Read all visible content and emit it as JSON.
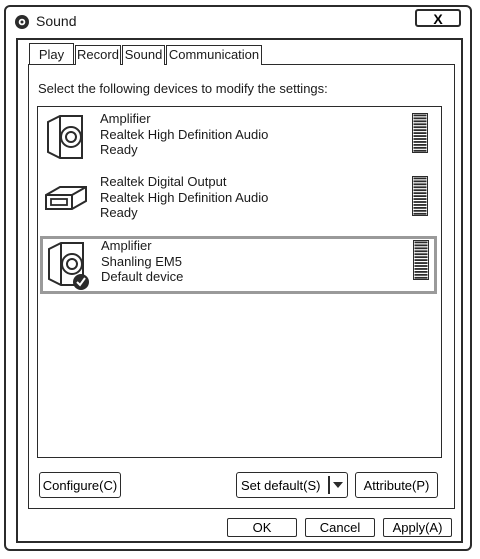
{
  "window": {
    "title": "Sound",
    "close_label": "X"
  },
  "tabs": [
    {
      "label": "Play",
      "active": true
    },
    {
      "label": "Record",
      "active": false
    },
    {
      "label": "Sound",
      "active": false
    },
    {
      "label": "Communication",
      "active": false
    }
  ],
  "instruction": "Select the following devices to modify the settings:",
  "devices": [
    {
      "name": "Amplifier",
      "driver": "Realtek High Definition Audio",
      "status": "Ready",
      "icon": "speaker-icon",
      "selected": false
    },
    {
      "name": "Realtek Digital Output",
      "driver": "Realtek High Definition Audio",
      "status": "Ready",
      "icon": "digital-output-icon",
      "selected": false
    },
    {
      "name": "Amplifier",
      "driver": "Shanling EM5",
      "status": "Default device",
      "icon": "speaker-icon",
      "selected": true,
      "badge": "default-check-icon"
    }
  ],
  "buttons": {
    "configure": "Configure(C)",
    "set_default": "Set default(S)",
    "attribute": "Attribute(P)",
    "ok": "OK",
    "cancel": "Cancel",
    "apply": "Apply(A)"
  }
}
